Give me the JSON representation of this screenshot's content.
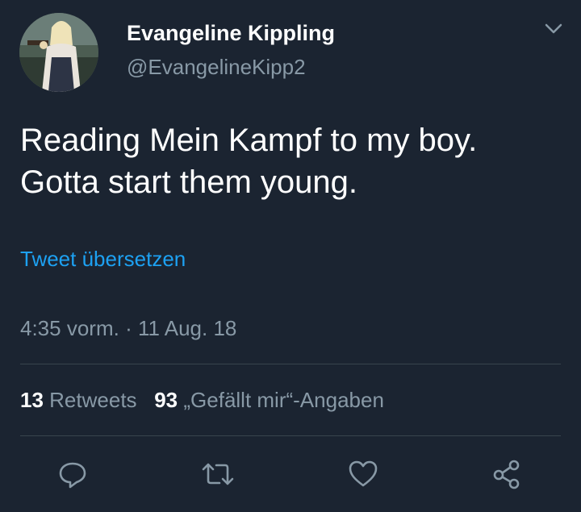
{
  "user": {
    "display_name": "Evangeline Kippling",
    "handle": "@EvangelineKipp2"
  },
  "tweet": {
    "lines": [
      "Reading Mein Kampf to my boy.",
      "Gotta start them young."
    ],
    "translate_label": "Tweet übersetzen",
    "time": "4:35 vorm.",
    "separator": "·",
    "date": "11 Aug. 18"
  },
  "stats": {
    "retweet_count": "13",
    "retweet_label": "Retweets",
    "like_count": "93",
    "like_label": "„Gefällt mir“-Angaben"
  },
  "actions": {
    "reply": "reply-icon",
    "retweet": "retweet-icon",
    "like": "heart-icon",
    "share": "share-icon"
  },
  "colors": {
    "background": "#1b2431",
    "text": "#ffffff",
    "muted": "#8899a6",
    "link": "#1da1f2",
    "divider": "#38444d"
  }
}
